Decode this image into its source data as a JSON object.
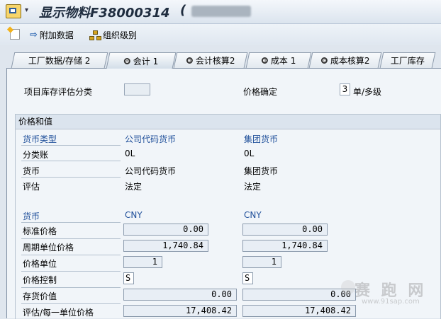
{
  "window": {
    "title": "显示物料F38000314",
    "title_open_paren": "("
  },
  "toolbar": {
    "items": [
      {
        "label": "附加数据"
      },
      {
        "label": "组织级别"
      }
    ]
  },
  "tabs": [
    {
      "label": "工厂数据/存储 2",
      "icon": "none",
      "active": false
    },
    {
      "label": "会计 1",
      "icon": "radio-icon",
      "active": true
    },
    {
      "label": "会计核算2",
      "icon": "radio-icon",
      "active": false
    },
    {
      "label": "成本 1",
      "icon": "radio-icon",
      "active": false
    },
    {
      "label": "成本核算2",
      "icon": "radio-icon",
      "active": false
    },
    {
      "label": "工厂库存",
      "icon": "none",
      "active": false
    }
  ],
  "top_fields": {
    "valuation_category_label": "项目库存评估分类",
    "valuation_category_value": "",
    "price_determination_label": "价格确定",
    "price_determination_value": "3",
    "price_determination_text": "单/多级"
  },
  "prices_group": {
    "title": "价格和值",
    "currency_type_label": "货币类型",
    "currency_type_col1": "公司代码货币",
    "currency_type_col2": "集团货币",
    "ledger_label": "分类账",
    "ledger_col1": "0L",
    "ledger_col2": "0L",
    "currency_label": "货币",
    "currency_col1": "公司代码货币",
    "currency_col2": "集团货币",
    "valuation_label": "评估",
    "valuation_col1": "法定",
    "valuation_col2": "法定",
    "currency2_label": "货币",
    "currency2_col1": "CNY",
    "currency2_col2": "CNY",
    "standard_price_label": "标准价格",
    "standard_price_col1": "0.00",
    "standard_price_col2": "0.00",
    "periodic_unit_price_label": "周期单位价格",
    "periodic_unit_price_col1": "1,740.84",
    "periodic_unit_price_col2": "1,740.84",
    "price_unit_label": "价格单位",
    "price_unit_col1": "1",
    "price_unit_col2": "1",
    "price_control_label": "价格控制",
    "price_control_col1": "S",
    "price_control_col2": "S",
    "inventory_value_label": "存货价值",
    "inventory_value_col1": "0.00",
    "inventory_value_col2": "0.00",
    "valuation_per_unit_label": "评估/每一单位价格",
    "valuation_per_unit_col1": "17,408.42",
    "valuation_per_unit_col2": "17,408.42"
  },
  "watermark": {
    "text": "赛 跑 网",
    "url": "www.91sap.com"
  }
}
